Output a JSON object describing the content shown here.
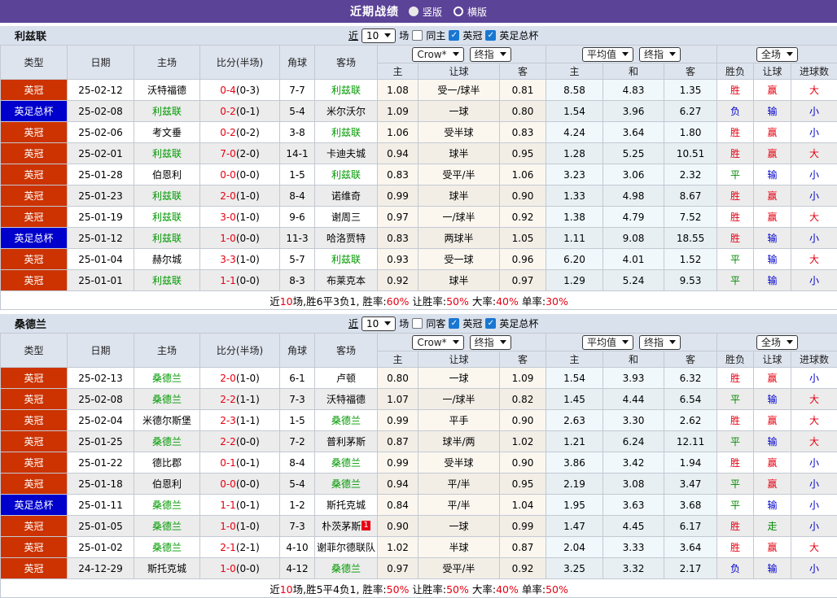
{
  "topbar": {
    "title": "近期战绩",
    "radios": [
      {
        "label": "竖版",
        "selected": true
      },
      {
        "label": "横版",
        "selected": false
      }
    ]
  },
  "labels": {
    "near": "近",
    "games": "场",
    "league1": "英冠",
    "league2": "英足总杯"
  },
  "header": {
    "cols": [
      "类型",
      "日期",
      "主场",
      "比分(半场)",
      "角球",
      "客场"
    ],
    "selects": {
      "crow": "Crow*",
      "crow_final": "终指",
      "avg": "平均值",
      "avg_final": "终指",
      "scope": "全场"
    },
    "sub": [
      "主",
      "让球",
      "客",
      "主",
      "和",
      "客",
      "胜负",
      "让球",
      "进球数"
    ]
  },
  "colors": {
    "accent_purple": "#5b4397",
    "league_championship_bg": "#cc3300",
    "fa_cup_bg": "#0000cc",
    "team_highlight_green": "#009900",
    "result_red": "#e60012",
    "result_blue": "#0000cc",
    "result_green": "#008800",
    "checkbox_blue": "#1977d2"
  },
  "result_colors": {
    "胜": "#e60012",
    "平": "#008800",
    "负": "#0000cc",
    "赢": "#e60012",
    "输": "#0000cc",
    "走": "#008800",
    "大": "#e60012",
    "小": "#0000cc"
  },
  "sections": [
    {
      "team": "利兹联",
      "count": "10",
      "same_label": "同主",
      "rows": [
        {
          "type": "英冠",
          "date": "25-02-12",
          "home": "沃特福德",
          "home_hl": false,
          "score": "0-4",
          "half": "(0-3)",
          "corners": "7-7",
          "away": "利兹联",
          "away_hl": true,
          "ch": "1.08",
          "hd": "受一/球半",
          "ca": "0.81",
          "ah": "8.58",
          "ad": "4.83",
          "aa": "1.35",
          "r1": "胜",
          "r2": "赢",
          "r3": "大"
        },
        {
          "type": "英足总杯",
          "date": "25-02-08",
          "home": "利兹联",
          "home_hl": true,
          "score": "0-2",
          "half": "(0-1)",
          "corners": "5-4",
          "away": "米尔沃尔",
          "away_hl": false,
          "ch": "1.09",
          "hd": "一球",
          "ca": "0.80",
          "ah": "1.54",
          "ad": "3.96",
          "aa": "6.27",
          "r1": "负",
          "r2": "输",
          "r3": "小"
        },
        {
          "type": "英冠",
          "date": "25-02-06",
          "home": "考文垂",
          "home_hl": false,
          "score": "0-2",
          "half": "(0-2)",
          "corners": "3-8",
          "away": "利兹联",
          "away_hl": true,
          "ch": "1.06",
          "hd": "受半球",
          "ca": "0.83",
          "ah": "4.24",
          "ad": "3.64",
          "aa": "1.80",
          "r1": "胜",
          "r2": "赢",
          "r3": "小"
        },
        {
          "type": "英冠",
          "date": "25-02-01",
          "home": "利兹联",
          "home_hl": true,
          "score": "7-0",
          "half": "(2-0)",
          "corners": "14-1",
          "away": "卡迪夫城",
          "away_hl": false,
          "ch": "0.94",
          "hd": "球半",
          "ca": "0.95",
          "ah": "1.28",
          "ad": "5.25",
          "aa": "10.51",
          "r1": "胜",
          "r2": "赢",
          "r3": "大"
        },
        {
          "type": "英冠",
          "date": "25-01-28",
          "home": "伯恩利",
          "home_hl": false,
          "score": "0-0",
          "half": "(0-0)",
          "corners": "1-5",
          "away": "利兹联",
          "away_hl": true,
          "ch": "0.83",
          "hd": "受平/半",
          "ca": "1.06",
          "ah": "3.23",
          "ad": "3.06",
          "aa": "2.32",
          "r1": "平",
          "r2": "输",
          "r3": "小"
        },
        {
          "type": "英冠",
          "date": "25-01-23",
          "home": "利兹联",
          "home_hl": true,
          "score": "2-0",
          "half": "(1-0)",
          "corners": "8-4",
          "away": "诺维奇",
          "away_hl": false,
          "ch": "0.99",
          "hd": "球半",
          "ca": "0.90",
          "ah": "1.33",
          "ad": "4.98",
          "aa": "8.67",
          "r1": "胜",
          "r2": "赢",
          "r3": "小"
        },
        {
          "type": "英冠",
          "date": "25-01-19",
          "home": "利兹联",
          "home_hl": true,
          "score": "3-0",
          "half": "(1-0)",
          "corners": "9-6",
          "away": "谢周三",
          "away_hl": false,
          "ch": "0.97",
          "hd": "一/球半",
          "ca": "0.92",
          "ah": "1.38",
          "ad": "4.79",
          "aa": "7.52",
          "r1": "胜",
          "r2": "赢",
          "r3": "大"
        },
        {
          "type": "英足总杯",
          "date": "25-01-12",
          "home": "利兹联",
          "home_hl": true,
          "score": "1-0",
          "half": "(0-0)",
          "corners": "11-3",
          "away": "哈洛贾特",
          "away_hl": false,
          "ch": "0.83",
          "hd": "两球半",
          "ca": "1.05",
          "ah": "1.11",
          "ad": "9.08",
          "aa": "18.55",
          "r1": "胜",
          "r2": "输",
          "r3": "小"
        },
        {
          "type": "英冠",
          "date": "25-01-04",
          "home": "赫尔城",
          "home_hl": false,
          "score": "3-3",
          "half": "(1-0)",
          "corners": "5-7",
          "away": "利兹联",
          "away_hl": true,
          "ch": "0.93",
          "hd": "受一球",
          "ca": "0.96",
          "ah": "6.20",
          "ad": "4.01",
          "aa": "1.52",
          "r1": "平",
          "r2": "输",
          "r3": "大"
        },
        {
          "type": "英冠",
          "date": "25-01-01",
          "home": "利兹联",
          "home_hl": true,
          "score": "1-1",
          "half": "(0-0)",
          "corners": "8-3",
          "away": "布莱克本",
          "away_hl": false,
          "ch": "0.92",
          "hd": "球半",
          "ca": "0.97",
          "ah": "1.29",
          "ad": "5.24",
          "aa": "9.53",
          "r1": "平",
          "r2": "输",
          "r3": "小"
        }
      ],
      "summary": [
        {
          "t": "近"
        },
        {
          "t": "10",
          "red": true
        },
        {
          "t": "场,胜6平3负1, 胜率:"
        },
        {
          "t": "60%",
          "red": true
        },
        {
          "t": " 让胜率:"
        },
        {
          "t": "50%",
          "red": true
        },
        {
          "t": " 大率:"
        },
        {
          "t": "40%",
          "red": true
        },
        {
          "t": " 单率:"
        },
        {
          "t": "30%",
          "red": true
        }
      ]
    },
    {
      "team": "桑德兰",
      "count": "10",
      "same_label": "同客",
      "rows": [
        {
          "type": "英冠",
          "date": "25-02-13",
          "home": "桑德兰",
          "home_hl": true,
          "score": "2-0",
          "half": "(1-0)",
          "corners": "6-1",
          "away": "卢顿",
          "away_hl": false,
          "ch": "0.80",
          "hd": "一球",
          "ca": "1.09",
          "ah": "1.54",
          "ad": "3.93",
          "aa": "6.32",
          "r1": "胜",
          "r2": "赢",
          "r3": "小"
        },
        {
          "type": "英冠",
          "date": "25-02-08",
          "home": "桑德兰",
          "home_hl": true,
          "score": "2-2",
          "half": "(1-1)",
          "corners": "7-3",
          "away": "沃特福德",
          "away_hl": false,
          "ch": "1.07",
          "hd": "一/球半",
          "ca": "0.82",
          "ah": "1.45",
          "ad": "4.44",
          "aa": "6.54",
          "r1": "平",
          "r2": "输",
          "r3": "大"
        },
        {
          "type": "英冠",
          "date": "25-02-04",
          "home": "米德尔斯堡",
          "home_hl": false,
          "score": "2-3",
          "half": "(1-1)",
          "corners": "1-5",
          "away": "桑德兰",
          "away_hl": true,
          "ch": "0.99",
          "hd": "平手",
          "ca": "0.90",
          "ah": "2.63",
          "ad": "3.30",
          "aa": "2.62",
          "r1": "胜",
          "r2": "赢",
          "r3": "大"
        },
        {
          "type": "英冠",
          "date": "25-01-25",
          "home": "桑德兰",
          "home_hl": true,
          "score": "2-2",
          "half": "(0-0)",
          "corners": "7-2",
          "away": "普利茅斯",
          "away_hl": false,
          "ch": "0.87",
          "hd": "球半/两",
          "ca": "1.02",
          "ah": "1.21",
          "ad": "6.24",
          "aa": "12.11",
          "r1": "平",
          "r2": "输",
          "r3": "大"
        },
        {
          "type": "英冠",
          "date": "25-01-22",
          "home": "德比郡",
          "home_hl": false,
          "score": "0-1",
          "half": "(0-1)",
          "corners": "8-4",
          "away": "桑德兰",
          "away_hl": true,
          "ch": "0.99",
          "hd": "受半球",
          "ca": "0.90",
          "ah": "3.86",
          "ad": "3.42",
          "aa": "1.94",
          "r1": "胜",
          "r2": "赢",
          "r3": "小"
        },
        {
          "type": "英冠",
          "date": "25-01-18",
          "home": "伯恩利",
          "home_hl": false,
          "score": "0-0",
          "half": "(0-0)",
          "corners": "5-4",
          "away": "桑德兰",
          "away_hl": true,
          "ch": "0.94",
          "hd": "平/半",
          "ca": "0.95",
          "ah": "2.19",
          "ad": "3.08",
          "aa": "3.47",
          "r1": "平",
          "r2": "赢",
          "r3": "小"
        },
        {
          "type": "英足总杯",
          "date": "25-01-11",
          "home": "桑德兰",
          "home_hl": true,
          "score": "1-1",
          "half": "(0-1)",
          "corners": "1-2",
          "away": "斯托克城",
          "away_hl": false,
          "ch": "0.84",
          "hd": "平/半",
          "ca": "1.04",
          "ah": "1.95",
          "ad": "3.63",
          "aa": "3.68",
          "r1": "平",
          "r2": "输",
          "r3": "小"
        },
        {
          "type": "英冠",
          "date": "25-01-05",
          "home": "桑德兰",
          "home_hl": true,
          "score": "1-0",
          "half": "(1-0)",
          "corners": "7-3",
          "away": "朴茨茅斯",
          "away_hl": false,
          "away_badge": "1",
          "ch": "0.90",
          "hd": "一球",
          "ca": "0.99",
          "ah": "1.47",
          "ad": "4.45",
          "aa": "6.17",
          "r1": "胜",
          "r2": "走",
          "r3": "小"
        },
        {
          "type": "英冠",
          "date": "25-01-02",
          "home": "桑德兰",
          "home_hl": true,
          "score": "2-1",
          "half": "(2-1)",
          "corners": "4-10",
          "away": "谢菲尔德联队",
          "away_hl": false,
          "ch": "1.02",
          "hd": "半球",
          "ca": "0.87",
          "ah": "2.04",
          "ad": "3.33",
          "aa": "3.64",
          "r1": "胜",
          "r2": "赢",
          "r3": "大"
        },
        {
          "type": "英冠",
          "date": "24-12-29",
          "home": "斯托克城",
          "home_hl": false,
          "score": "1-0",
          "half": "(0-0)",
          "corners": "4-12",
          "away": "桑德兰",
          "away_hl": true,
          "ch": "0.97",
          "hd": "受平/半",
          "ca": "0.92",
          "ah": "3.25",
          "ad": "3.32",
          "aa": "2.17",
          "r1": "负",
          "r2": "输",
          "r3": "小"
        }
      ],
      "summary": [
        {
          "t": "近"
        },
        {
          "t": "10",
          "red": true
        },
        {
          "t": "场,胜5平4负1, 胜率:"
        },
        {
          "t": "50%",
          "red": true
        },
        {
          "t": " 让胜率:"
        },
        {
          "t": "50%",
          "red": true
        },
        {
          "t": " 大率:"
        },
        {
          "t": "40%",
          "red": true
        },
        {
          "t": " 单率:"
        },
        {
          "t": "50%",
          "red": true
        }
      ]
    }
  ]
}
